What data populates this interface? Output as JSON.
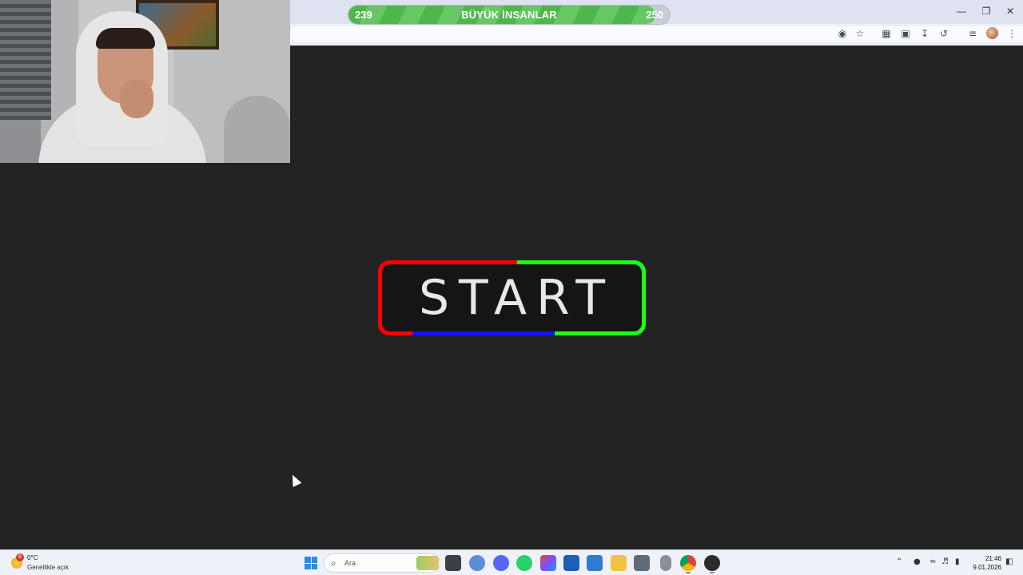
{
  "progress": {
    "current": "239",
    "target": "250",
    "title": "BÜYÜK İNSANLAR",
    "fill_fraction": 0.956
  },
  "game": {
    "start_label": "START"
  },
  "browser": {
    "icons": [
      "eye-off-icon",
      "star-icon",
      "translate-icon",
      "extensions-icon",
      "download-icon",
      "history-icon",
      "tab-search-icon",
      "profile-avatar",
      "more-menu-icon"
    ],
    "window_controls": [
      "minimize-icon",
      "restore-icon",
      "close-icon"
    ]
  },
  "taskbar": {
    "weather": {
      "badge": "6",
      "temp": "0°C",
      "desc": "Genellikle açık"
    },
    "search": {
      "placeholder": "Ara"
    },
    "apps": [
      "file-explorer-app",
      "copilot-app",
      "discord-app",
      "whatsapp-app",
      "office-app",
      "store-app",
      "photos-app",
      "folder-app",
      "calculator-app",
      "mouse-app",
      "chrome-app",
      "obs-app"
    ],
    "clock": {
      "time": "21:46",
      "date": "9.01.2026"
    }
  },
  "colors": {
    "accent_green": "#4db84a",
    "border_red": "#ff0000",
    "border_green": "#1cff12",
    "border_blue": "#1212ff",
    "background": "#232323"
  }
}
